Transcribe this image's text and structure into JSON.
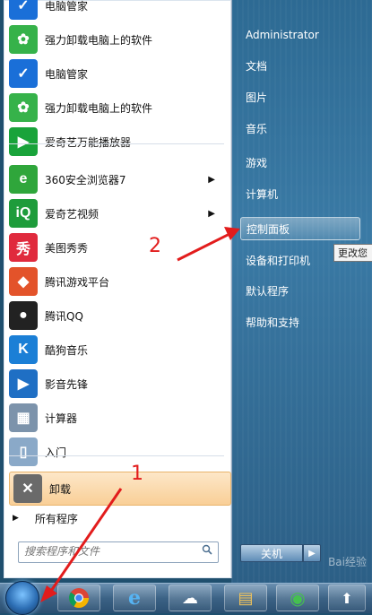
{
  "user": {
    "name": "Administrator"
  },
  "left_menu": {
    "items": [
      {
        "label": "电脑管家",
        "icon": "tencent-pc-manager-icon",
        "color": "#1a6fd8",
        "glyph": "✓"
      },
      {
        "label": "强力卸载电脑上的软件",
        "icon": "uninstaller-icon",
        "color": "#36b24a",
        "glyph": "✿"
      },
      {
        "label": "电脑管家",
        "icon": "tencent-pc-manager-icon",
        "color": "#1a6fd8",
        "glyph": "✓"
      },
      {
        "label": "强力卸载电脑上的软件",
        "icon": "uninstaller-icon",
        "color": "#36b24a",
        "glyph": "✿"
      },
      {
        "label": "爱奇艺万能播放器",
        "icon": "iqiyi-player-icon",
        "color": "#19a33a",
        "glyph": "▶"
      },
      {
        "label": "360安全浏览器7",
        "icon": "360-browser-icon",
        "color": "#2fa63b",
        "glyph": "e",
        "submenu": true
      },
      {
        "label": "爱奇艺视频",
        "icon": "iqiyi-video-icon",
        "color": "#1e9c3b",
        "glyph": "iQ",
        "submenu": true
      },
      {
        "label": "美图秀秀",
        "icon": "meitu-icon",
        "color": "#e02a3d",
        "glyph": "秀"
      },
      {
        "label": "腾讯游戏平台",
        "icon": "tencent-games-icon",
        "color": "#e3532a",
        "glyph": "◆"
      },
      {
        "label": "腾讯QQ",
        "icon": "qq-penguin-icon",
        "color": "#222222",
        "glyph": "●"
      },
      {
        "label": "酷狗音乐",
        "icon": "kugou-icon",
        "color": "#1b7fd6",
        "glyph": "K"
      },
      {
        "label": "影音先锋",
        "icon": "xfplay-icon",
        "color": "#1f6fc4",
        "glyph": "▶"
      },
      {
        "label": "计算器",
        "icon": "calculator-icon",
        "color": "#7c93ab",
        "glyph": "▦"
      },
      {
        "label": "入门",
        "icon": "getting-started-icon",
        "color": "#8aa9c8",
        "glyph": "▯"
      },
      {
        "label": "卸载",
        "icon": "uninstall-icon",
        "color": "#6a6a6a",
        "glyph": "✕"
      }
    ],
    "all_programs": "所有程序",
    "search_placeholder": "搜索程序和文件"
  },
  "right_menu": {
    "items": [
      {
        "label": "文档"
      },
      {
        "label": "图片"
      },
      {
        "label": "音乐"
      },
      {
        "label": "游戏"
      },
      {
        "label": "计算机"
      },
      {
        "label": "控制面板"
      },
      {
        "label": "设备和打印机"
      },
      {
        "label": "默认程序"
      },
      {
        "label": "帮助和支持"
      }
    ],
    "tooltip": "更改您",
    "shutdown_label": "关机"
  },
  "annotations": {
    "step1": "1",
    "step2": "2",
    "color": "#e21c1c"
  },
  "watermark": "Bai经验"
}
